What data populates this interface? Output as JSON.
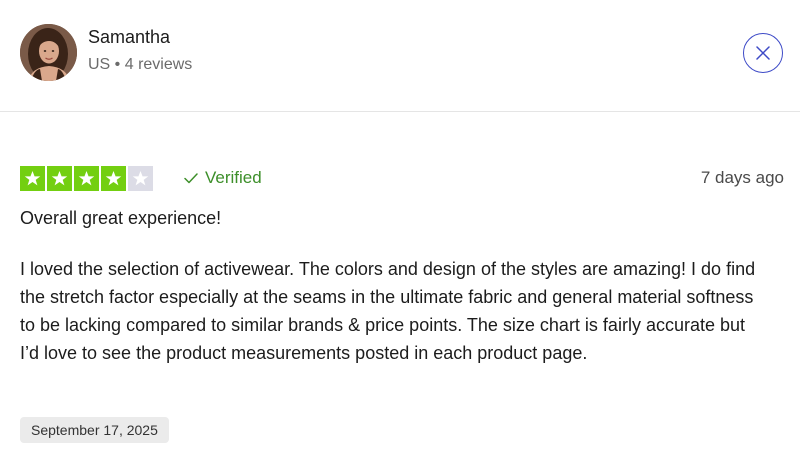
{
  "reviewer": {
    "name": "Samantha",
    "meta": "US • 4 reviews",
    "avatar_icon": "user-photo"
  },
  "close_icon": "close-icon",
  "review": {
    "rating": 4,
    "max_rating": 5,
    "verified_label": "Verified",
    "date_ago": "7 days ago",
    "title": "Overall great experience!",
    "body": "I loved the selection of activewear. The colors and design of the styles are amazing! I do find the stretch factor especially at the seams in the ultimate fabric and general material softness to be lacking compared to similar brands & price points. The size chart is fairly accurate but I’d love to see the product measurements posted in each product page.",
    "experience_date": "September 17, 2025"
  },
  "colors": {
    "star_filled": "#73cf11",
    "star_empty": "#dcdce6",
    "verified": "#3d8f2a",
    "close_accent": "#3d4ac7"
  }
}
